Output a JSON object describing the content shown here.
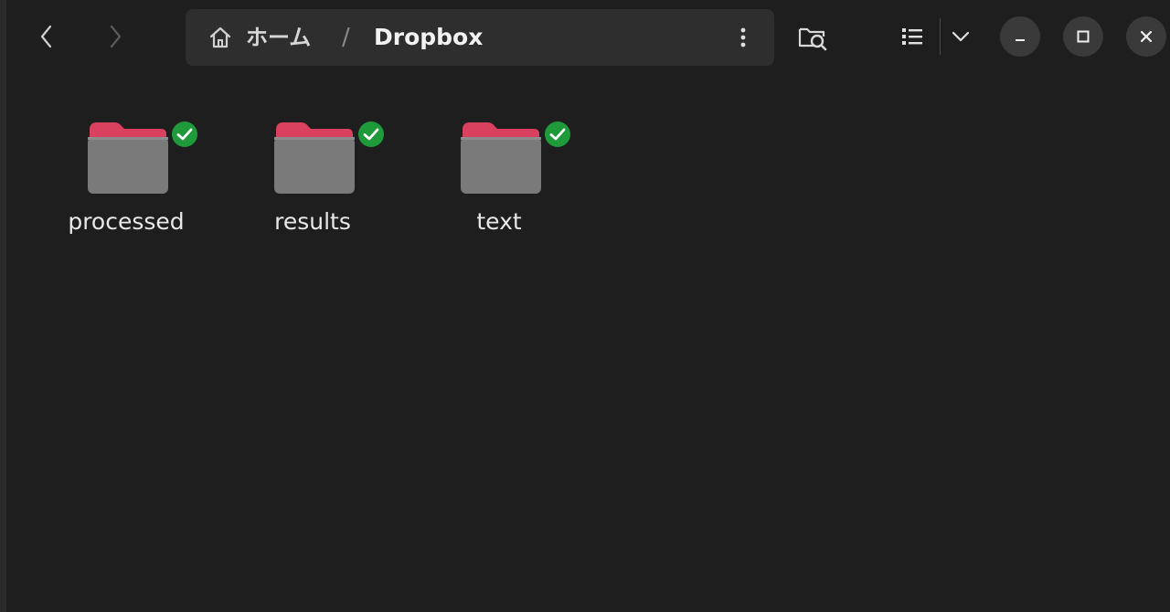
{
  "navigation": {
    "back_icon": "chevron-left-icon",
    "forward_icon": "chevron-right-icon"
  },
  "pathbar": {
    "home_label": "ホーム",
    "separator": "/",
    "current_folder": "Dropbox",
    "menu_icon": "vertical-dots-icon"
  },
  "toolbar": {
    "search_icon": "folder-search-icon",
    "view_icon": "list-view-icon",
    "view_options_icon": "chevron-down-icon"
  },
  "window_controls": {
    "minimize_icon": "minimize-icon",
    "maximize_icon": "maximize-icon",
    "close_icon": "close-icon"
  },
  "files": [
    {
      "name": "processed",
      "type": "folder",
      "sync_status": "synced"
    },
    {
      "name": "results",
      "type": "folder",
      "sync_status": "synced"
    },
    {
      "name": "text",
      "type": "folder",
      "sync_status": "synced"
    }
  ],
  "colors": {
    "background": "#1e1e1e",
    "pathbar_bg": "#2e2e2e",
    "folder_tab": "#d9415f",
    "folder_body": "#7a7a7a",
    "sync_badge": "#1e9a3b"
  }
}
